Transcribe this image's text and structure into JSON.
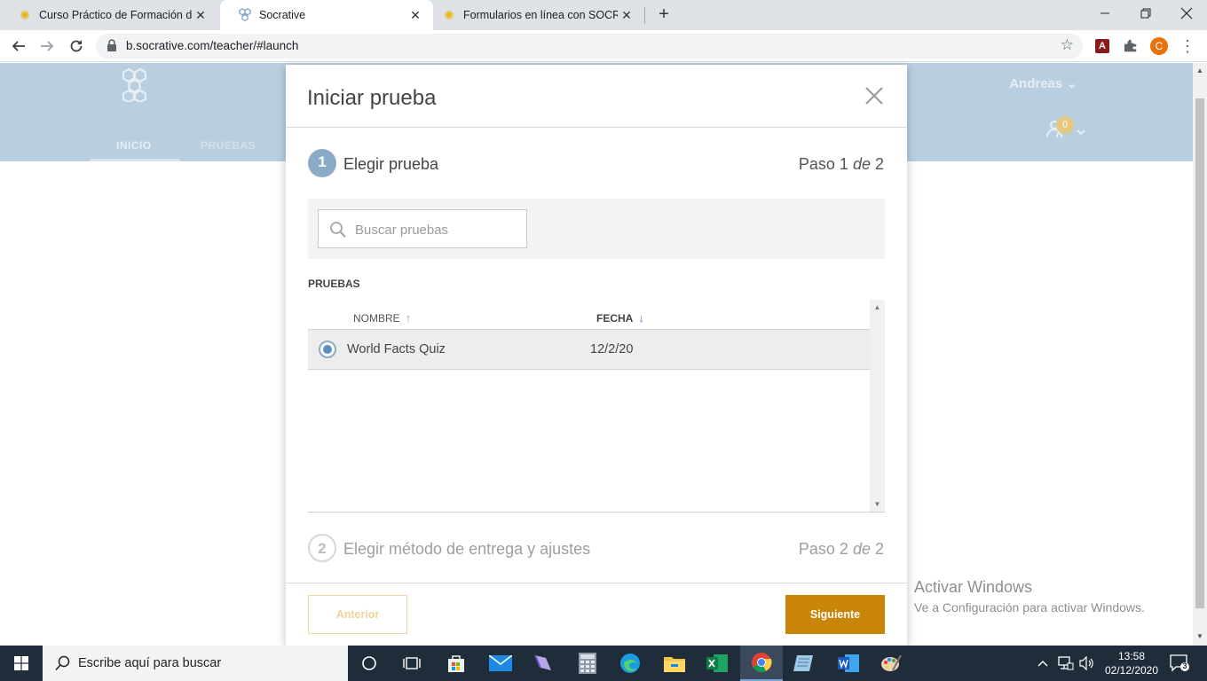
{
  "browser": {
    "tabs": [
      {
        "title": "Curso Práctico de Formación de Pr",
        "icon": "sun-favicon-icon",
        "close": "✕"
      },
      {
        "title": "Socrative",
        "icon": "socrative-favicon-icon",
        "close": "✕"
      },
      {
        "title": "Formularios en línea con SOCRATIVE",
        "icon": "sun-favicon-icon",
        "close": "✕"
      }
    ],
    "new_tab": "+",
    "url": "b.socrative.com/teacher/#launch",
    "profile_initial": "C"
  },
  "site": {
    "nav": [
      "INICIO",
      "PRUEBAS"
    ],
    "user_name": "Andreas",
    "rooms_badge": "0"
  },
  "modal": {
    "title": "Iniciar prueba",
    "step1": {
      "number": "1",
      "label": "Elegir prueba",
      "count_prefix": "Paso 1",
      "count_de": "de",
      "count_total": "2"
    },
    "search": {
      "placeholder": "Buscar pruebas",
      "value": ""
    },
    "section_label": "PRUEBAS",
    "columns": {
      "name": "NOMBRE",
      "date": "FECHA"
    },
    "rows": [
      {
        "name": "World Facts Quiz",
        "date": "12/2/20",
        "selected": true
      }
    ],
    "step2": {
      "number": "2",
      "label": "Elegir método de entrega y ajustes",
      "count_prefix": "Paso 2",
      "count_de": "de",
      "count_total": "2"
    },
    "btn_prev": "Anterior",
    "btn_next": "Siguiente"
  },
  "watermark": {
    "line1": "Activar Windows",
    "line2": "Ve a Configuración para activar Windows."
  },
  "taskbar": {
    "search_text": "Escribe aquí para buscar",
    "time": "13:58",
    "date": "02/12/2020",
    "notifications": "3"
  },
  "colors": {
    "header_blue": "#b9cfe0",
    "accent_blue": "#8aabc7",
    "button_orange": "#c98508"
  }
}
